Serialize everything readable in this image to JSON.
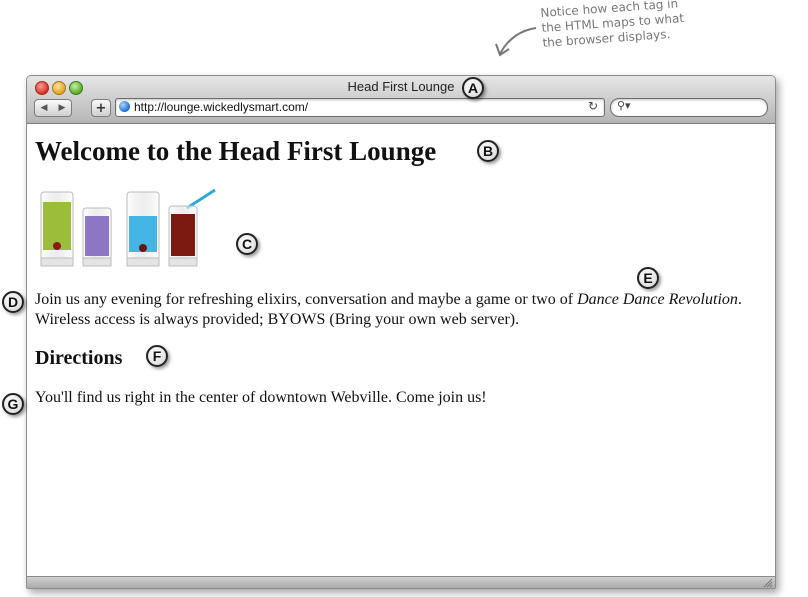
{
  "annotation": {
    "note_lines": [
      "Notice how each tag in",
      "the HTML maps to what",
      "the browser displays."
    ]
  },
  "browser": {
    "window_title": "Head First Lounge",
    "back_icon": "◀",
    "forward_icon": "▶",
    "add_label": "+",
    "url": "http://lounge.wickedlysmart.com/",
    "reload_icon": "↻",
    "search_icon": "⚲▾",
    "search_placeholder": ""
  },
  "page": {
    "heading": "Welcome to the Head First Lounge",
    "paragraph_start": "Join us any evening for refreshing elixirs, conversation and maybe a game or two of ",
    "paragraph_em": "Dance Dance Revolution",
    "paragraph_end": ". Wireless access is always provided; BYOWS (Bring your own web server).",
    "subheading": "Directions",
    "directions_text": "You'll find us right in the center of downtown Webville. Come join us!"
  },
  "callouts": [
    "A",
    "B",
    "C",
    "D",
    "E",
    "F",
    "G"
  ],
  "icons": {
    "drinks_image": "drinks-image",
    "globe": "globe-icon",
    "resize": "resize-grip-icon"
  }
}
